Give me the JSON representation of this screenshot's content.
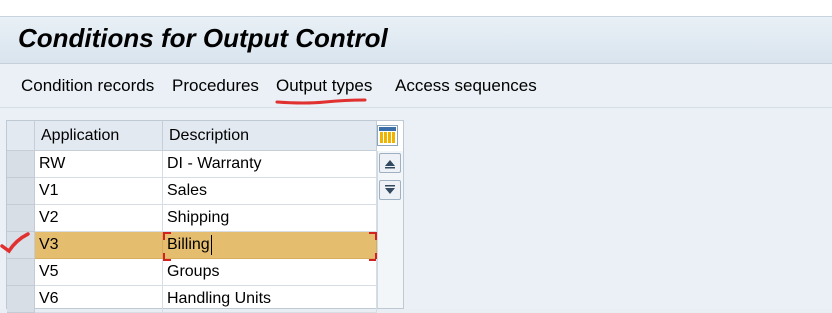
{
  "window": {
    "title": "Conditions for Output Control"
  },
  "menu": {
    "items": [
      {
        "label": "Condition records"
      },
      {
        "label": "Procedures"
      },
      {
        "label": "Output types"
      },
      {
        "label": "Access sequences"
      }
    ]
  },
  "table": {
    "headers": {
      "application": "Application",
      "description": "Description"
    },
    "settings_icon": "column-settings-icon",
    "rows": [
      {
        "application": "RW",
        "description": "DI - Warranty",
        "selected": false
      },
      {
        "application": "V1",
        "description": "Sales",
        "selected": false
      },
      {
        "application": "V2",
        "description": "Shipping",
        "selected": false
      },
      {
        "application": "V3",
        "description": "Billing",
        "selected": true
      },
      {
        "application": "V5",
        "description": "Groups",
        "selected": false
      },
      {
        "application": "V6",
        "description": "Handling Units",
        "selected": false
      }
    ]
  },
  "colors": {
    "selected_row": "#e5bd6e",
    "annotation_red": "#e03030",
    "title_bar": "#dce6ef"
  }
}
